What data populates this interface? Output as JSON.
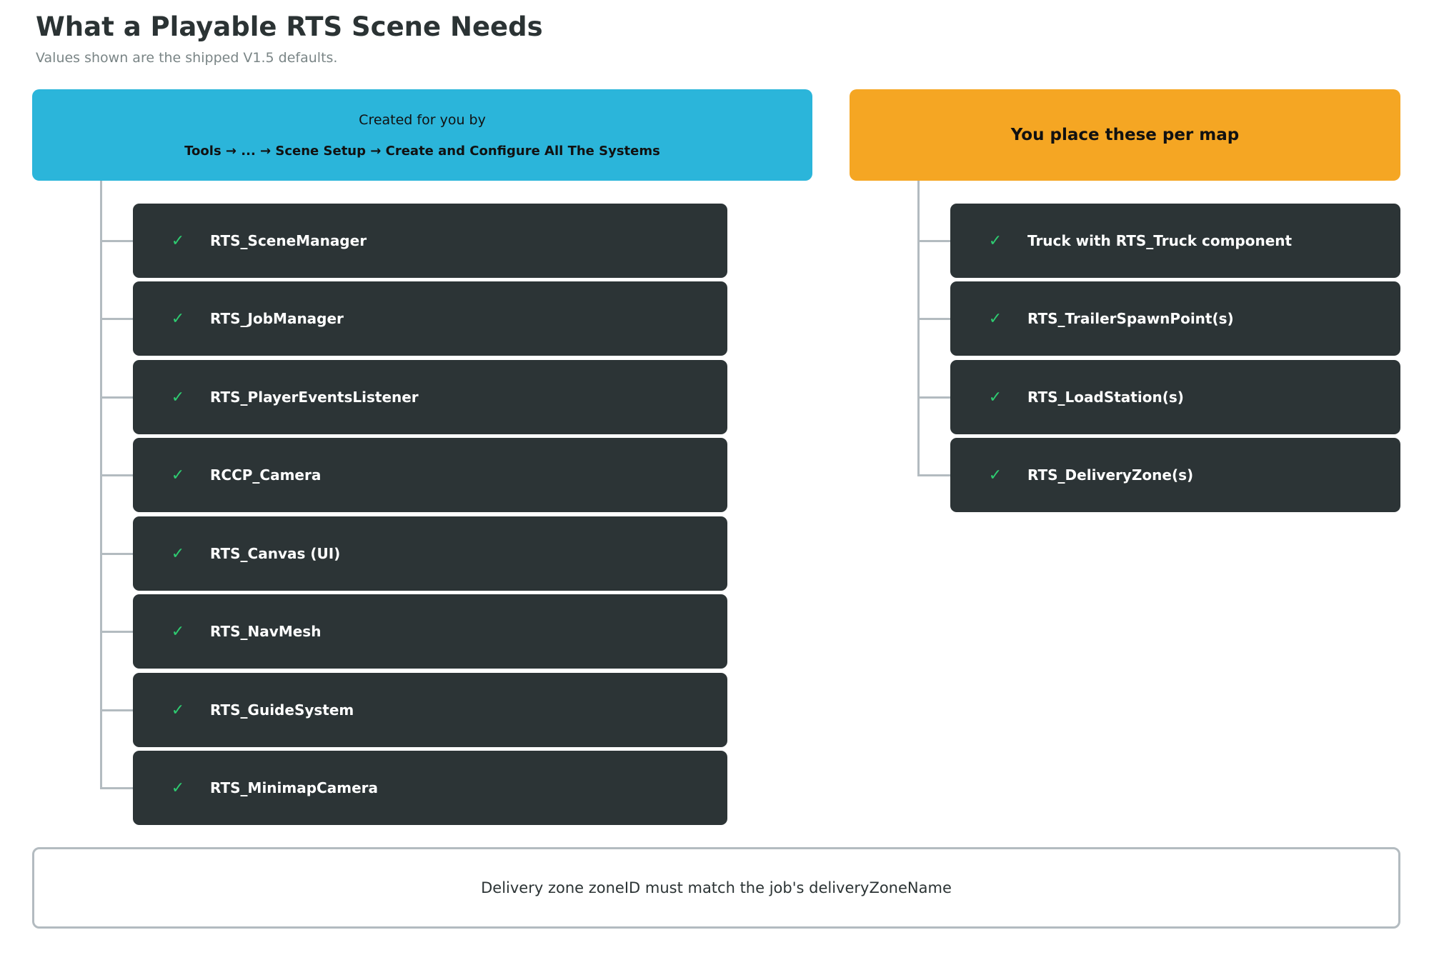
{
  "title": "What a Playable RTS Scene Needs",
  "subtitle": "Values shown are the shipped V1.5 defaults.",
  "colors": {
    "auto_header": "#2bb5da",
    "manual_header": "#f5a623",
    "item_bg": "#2c3436",
    "check": "#2ecc71",
    "connector": "#b3bbc0"
  },
  "auto_group": {
    "header_line1": "Created for you by",
    "header_line2": "Tools → ... → Scene Setup → Create and Configure All The Systems",
    "items": [
      {
        "check": "✓",
        "label": "RTS_SceneManager"
      },
      {
        "check": "✓",
        "label": "RTS_JobManager"
      },
      {
        "check": "✓",
        "label": "RTS_PlayerEventsListener"
      },
      {
        "check": "✓",
        "label": "RCCP_Camera"
      },
      {
        "check": "✓",
        "label": "RTS_Canvas (UI)"
      },
      {
        "check": "✓",
        "label": "RTS_NavMesh"
      },
      {
        "check": "✓",
        "label": "RTS_GuideSystem"
      },
      {
        "check": "✓",
        "label": "RTS_MinimapCamera"
      }
    ]
  },
  "manual_group": {
    "header": "You place these per map",
    "items": [
      {
        "check": "✓",
        "label": "Truck with RTS_Truck component"
      },
      {
        "check": "✓",
        "label": "RTS_TrailerSpawnPoint(s)"
      },
      {
        "check": "✓",
        "label": "RTS_LoadStation(s)"
      },
      {
        "check": "✓",
        "label": "RTS_DeliveryZone(s)"
      }
    ]
  },
  "note": "Delivery zone zoneID must match the job's deliveryZoneName"
}
